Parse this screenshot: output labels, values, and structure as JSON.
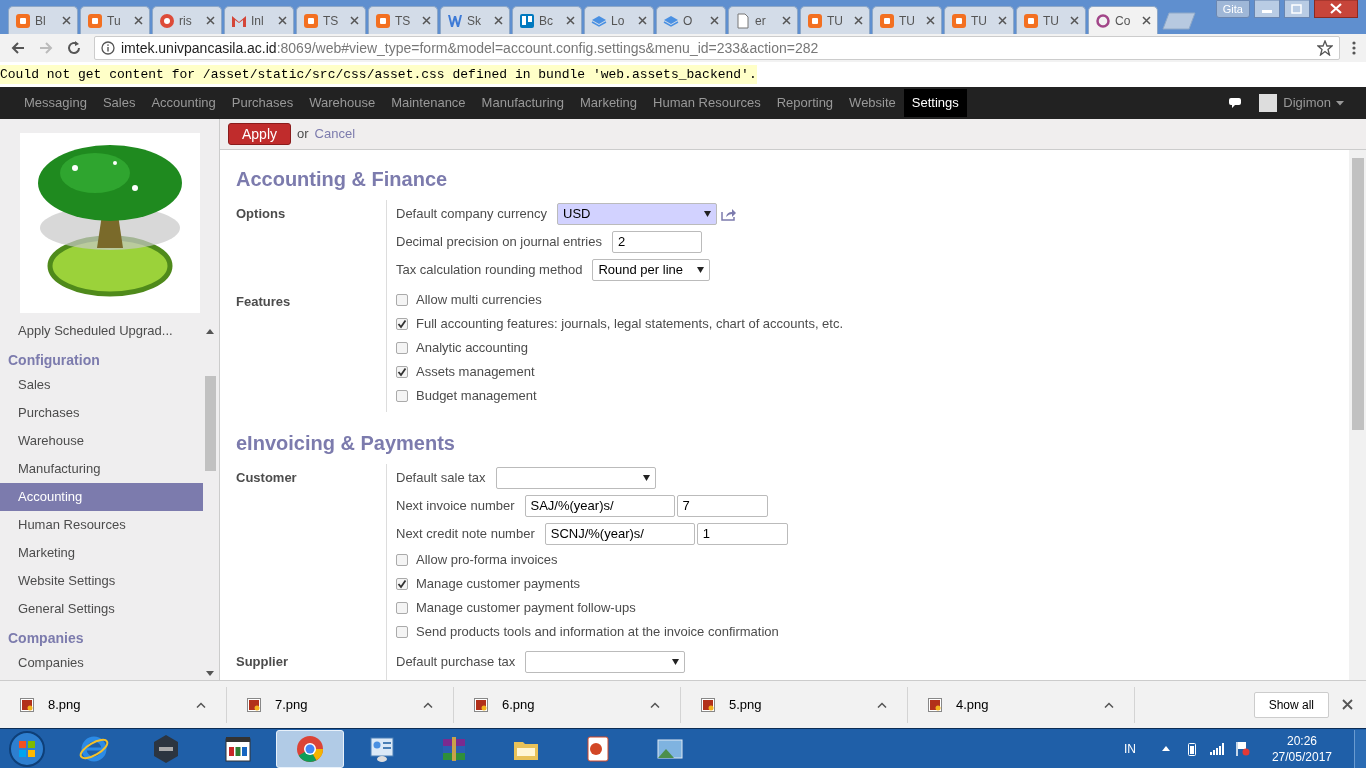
{
  "browser": {
    "tabs": [
      {
        "label": "Bl",
        "kind": "blogger",
        "selected": false
      },
      {
        "label": "Tu",
        "kind": "blogger",
        "selected": false
      },
      {
        "label": "ris",
        "kind": "gplus",
        "selected": false
      },
      {
        "label": "Inl",
        "kind": "gmail",
        "selected": false
      },
      {
        "label": "TS",
        "kind": "blogger",
        "selected": false
      },
      {
        "label": "TS",
        "kind": "blogger",
        "selected": false
      },
      {
        "label": "Sk",
        "kind": "word",
        "selected": false
      },
      {
        "label": "Bc",
        "kind": "board",
        "selected": false
      },
      {
        "label": "Lo",
        "kind": "layers",
        "selected": false
      },
      {
        "label": "O",
        "kind": "layers",
        "selected": false
      },
      {
        "label": "er",
        "kind": "page",
        "selected": false
      },
      {
        "label": "TU",
        "kind": "blogger",
        "selected": false
      },
      {
        "label": "TU",
        "kind": "blogger",
        "selected": false
      },
      {
        "label": "TU",
        "kind": "blogger",
        "selected": false
      },
      {
        "label": "TU",
        "kind": "blogger",
        "selected": false
      },
      {
        "label": "Co",
        "kind": "ring",
        "selected": true
      }
    ],
    "profile": "Gita",
    "url_host": "imtek.univpancasila.ac.id",
    "url_rest": ":8069/web#view_type=form&model=account.config.settings&menu_id=233&action=282"
  },
  "warning": "Could not get content for /asset/static/src/css/asset.css defined in bundle 'web.assets_backend'.",
  "top_menu": {
    "items": [
      {
        "label": "Messaging",
        "selected": false
      },
      {
        "label": "Sales",
        "selected": false
      },
      {
        "label": "Accounting",
        "selected": false
      },
      {
        "label": "Purchases",
        "selected": false
      },
      {
        "label": "Warehouse",
        "selected": false
      },
      {
        "label": "Maintenance",
        "selected": false
      },
      {
        "label": "Manufacturing",
        "selected": false
      },
      {
        "label": "Marketing",
        "selected": false
      },
      {
        "label": "Human Resources",
        "selected": false
      },
      {
        "label": "Reporting",
        "selected": false
      },
      {
        "label": "Website",
        "selected": false
      },
      {
        "label": "Settings",
        "selected": true
      }
    ],
    "user": "Digimon"
  },
  "toolbar": {
    "apply": "Apply",
    "or": "or",
    "cancel": "Cancel"
  },
  "sidebar": {
    "items": [
      {
        "label": "Apply Scheduled Upgrad...",
        "kind": "item",
        "selected": false
      },
      {
        "label": "Configuration",
        "kind": "header",
        "selected": false
      },
      {
        "label": "Sales",
        "kind": "item",
        "selected": false
      },
      {
        "label": "Purchases",
        "kind": "item",
        "selected": false
      },
      {
        "label": "Warehouse",
        "kind": "item",
        "selected": false
      },
      {
        "label": "Manufacturing",
        "kind": "item",
        "selected": false
      },
      {
        "label": "Accounting",
        "kind": "item",
        "selected": true
      },
      {
        "label": "Human Resources",
        "kind": "item",
        "selected": false
      },
      {
        "label": "Marketing",
        "kind": "item",
        "selected": false
      },
      {
        "label": "Website Settings",
        "kind": "item",
        "selected": false
      },
      {
        "label": "General Settings",
        "kind": "item",
        "selected": false
      },
      {
        "label": "Companies",
        "kind": "header",
        "selected": false
      },
      {
        "label": "Companies",
        "kind": "item",
        "selected": false
      }
    ]
  },
  "sections": [
    {
      "title": "Accounting & Finance",
      "groups": [
        {
          "label": "Options",
          "rows": [
            {
              "kind": "select",
              "label": "Default company currency",
              "value": "USD",
              "highlighted": true,
              "link": true
            },
            {
              "kind": "text",
              "label": "Decimal precision on journal entries",
              "value": "2"
            },
            {
              "kind": "select",
              "label": "Tax calculation rounding method",
              "value": "Round per line",
              "highlighted": false,
              "link": false
            }
          ]
        },
        {
          "label": "Features",
          "rows": [
            {
              "kind": "check",
              "label": "Allow multi currencies",
              "checked": false
            },
            {
              "kind": "check",
              "label": "Full accounting features: journals, legal statements, chart of accounts, etc.",
              "checked": true
            },
            {
              "kind": "check",
              "label": "Analytic accounting",
              "checked": false
            },
            {
              "kind": "check",
              "label": "Assets management",
              "checked": true
            },
            {
              "kind": "check",
              "label": "Budget management",
              "checked": false
            }
          ]
        }
      ]
    },
    {
      "title": "eInvoicing & Payments",
      "groups": [
        {
          "label": "Customer",
          "rows": [
            {
              "kind": "select",
              "label": "Default sale tax",
              "highlighted": false,
              "link": false
            },
            {
              "kind": "pair",
              "label": "Next invoice number",
              "value": "SAJ/%(year)s/",
              "number": "7"
            },
            {
              "kind": "pair",
              "label": "Next credit note number",
              "value": "SCNJ/%(year)s/",
              "number": "1"
            },
            {
              "kind": "check",
              "label": "Allow pro-forma invoices",
              "checked": false
            },
            {
              "kind": "check",
              "label": "Manage customer payments",
              "checked": true
            },
            {
              "kind": "check",
              "label": "Manage customer payment follow-ups",
              "checked": false
            },
            {
              "kind": "check",
              "label": "Send products tools and information at the invoice confirmation",
              "checked": false
            }
          ]
        },
        {
          "label": "Supplier",
          "rows": [
            {
              "kind": "select",
              "label": "Default purchase tax",
              "highlighted": false,
              "link": false
            }
          ]
        }
      ]
    }
  ],
  "downloads": {
    "files": [
      {
        "name": "8.png"
      },
      {
        "name": "7.png"
      },
      {
        "name": "6.png"
      },
      {
        "name": "5.png"
      },
      {
        "name": "4.png"
      }
    ],
    "show_all": "Show all"
  },
  "taskbar": {
    "apps": [
      {
        "kind": "ie",
        "selected": false
      },
      {
        "kind": "nox",
        "selected": false
      },
      {
        "kind": "player",
        "selected": false
      },
      {
        "kind": "chrome",
        "selected": true
      },
      {
        "kind": "panel",
        "selected": false
      },
      {
        "kind": "archive",
        "selected": false
      },
      {
        "kind": "folder",
        "selected": false
      },
      {
        "kind": "slides",
        "selected": false
      },
      {
        "kind": "picture",
        "selected": false
      }
    ],
    "language": "IN",
    "time": "20:26",
    "date": "27/05/2017"
  }
}
